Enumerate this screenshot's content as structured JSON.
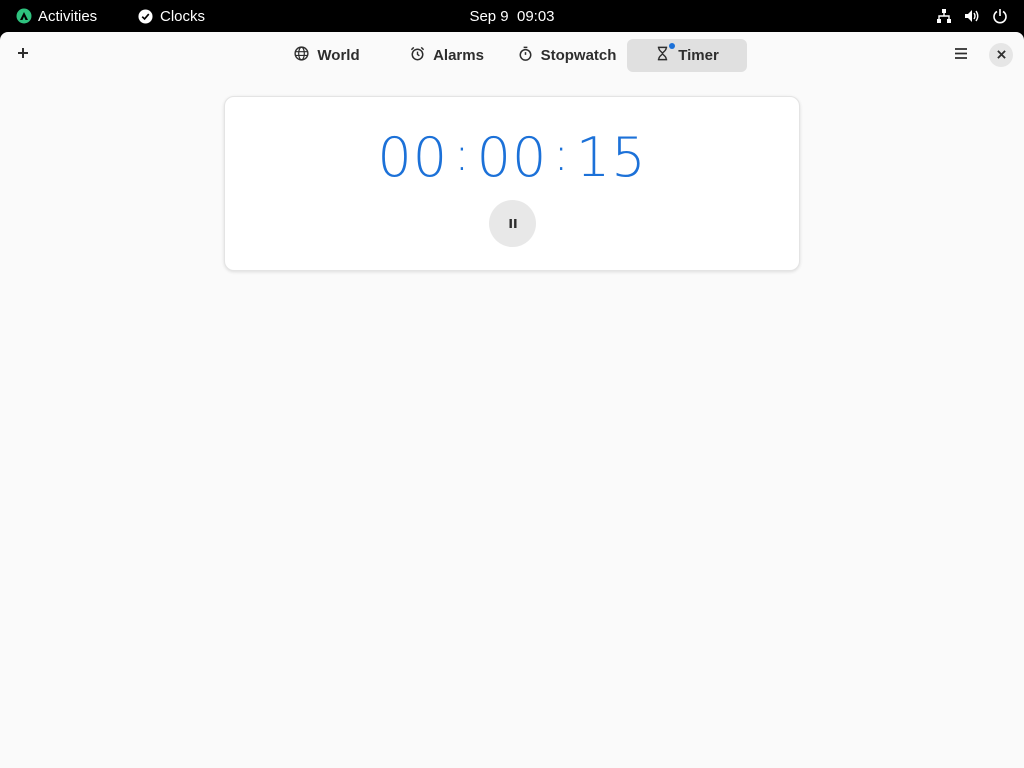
{
  "topbar": {
    "activities_label": "Activities",
    "app_name": "Clocks",
    "datetime": "Sep 9  09:03"
  },
  "headerbar": {
    "tabs": [
      {
        "label": "World",
        "icon": "globe-icon"
      },
      {
        "label": "Alarms",
        "icon": "alarm-clock-icon"
      },
      {
        "label": "Stopwatch",
        "icon": "stopwatch-icon"
      },
      {
        "label": "Timer",
        "icon": "hourglass-icon",
        "active": true
      }
    ]
  },
  "timer": {
    "hours": "00",
    "minutes": "00",
    "seconds": "15",
    "separator": ":"
  },
  "colors": {
    "accent": "#1c71d8",
    "window_bg": "#fafafa",
    "topbar_bg": "#000000",
    "activities_logo": "#2ec27e"
  }
}
